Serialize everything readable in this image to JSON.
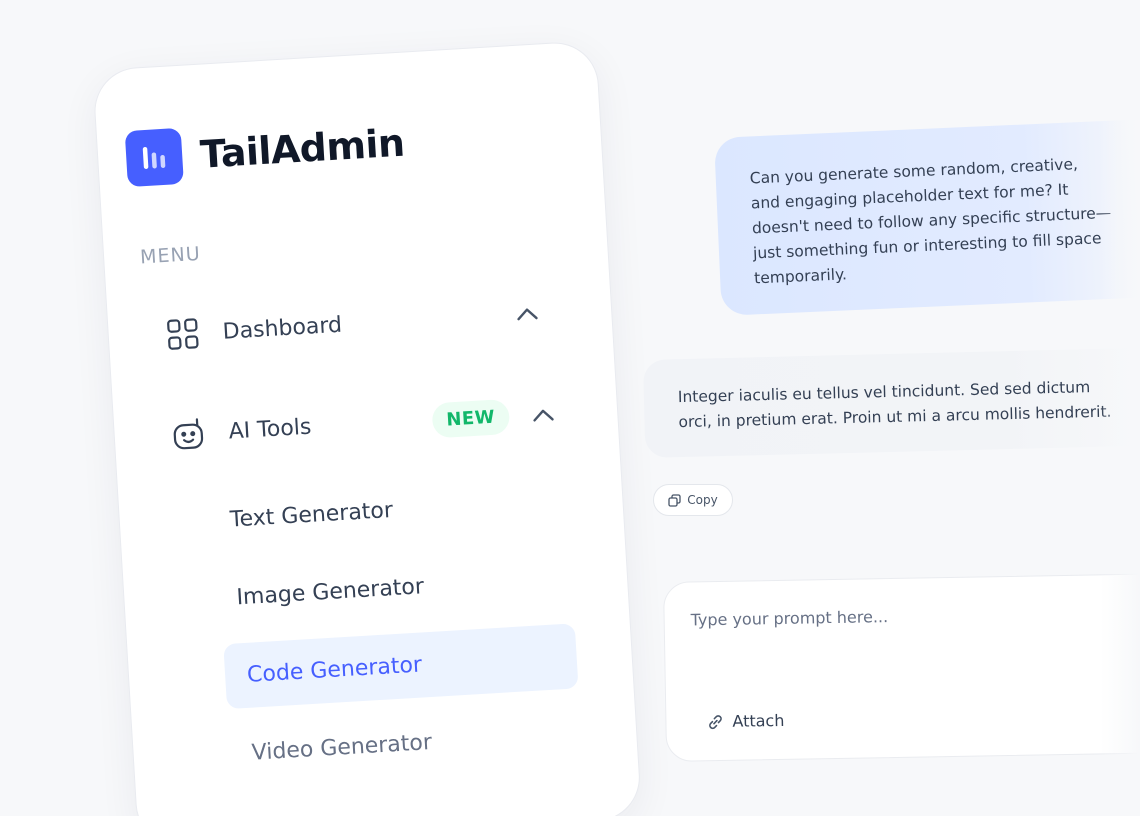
{
  "brand": {
    "name": "TailAdmin"
  },
  "sidebar": {
    "menu_label": "MENU",
    "items": [
      {
        "label": "Dashboard",
        "icon": "grid-icon",
        "expanded": true
      },
      {
        "label": "AI Tools",
        "icon": "robot-icon",
        "badge": "NEW",
        "expanded": true
      }
    ],
    "sub_items": [
      {
        "label": "Text Generator",
        "active": false
      },
      {
        "label": "Image Generator",
        "active": false
      },
      {
        "label": "Code Generator",
        "active": true
      },
      {
        "label": "Video Generator",
        "active": false
      }
    ]
  },
  "chat": {
    "user_message": "Can you generate some random, creative, and engaging placeholder text for me? It doesn't need to follow any specific structure—just something fun or interesting to fill space temporarily.",
    "ai_message": "Integer iaculis eu tellus vel tincidunt. Sed sed dictum orci, in pretium erat. Proin ut mi a arcu mollis hendrerit.",
    "copy_label": "Copy",
    "prompt_placeholder": "Type your prompt here...",
    "attach_label": "Attach"
  },
  "colors": {
    "brand": "#465fff",
    "active_bg": "#ecf3ff",
    "badge_bg": "#ecfdf3",
    "badge_text": "#12b76a",
    "user_bubble": "#dbe7ff",
    "ai_bubble": "#f2f4f7"
  }
}
